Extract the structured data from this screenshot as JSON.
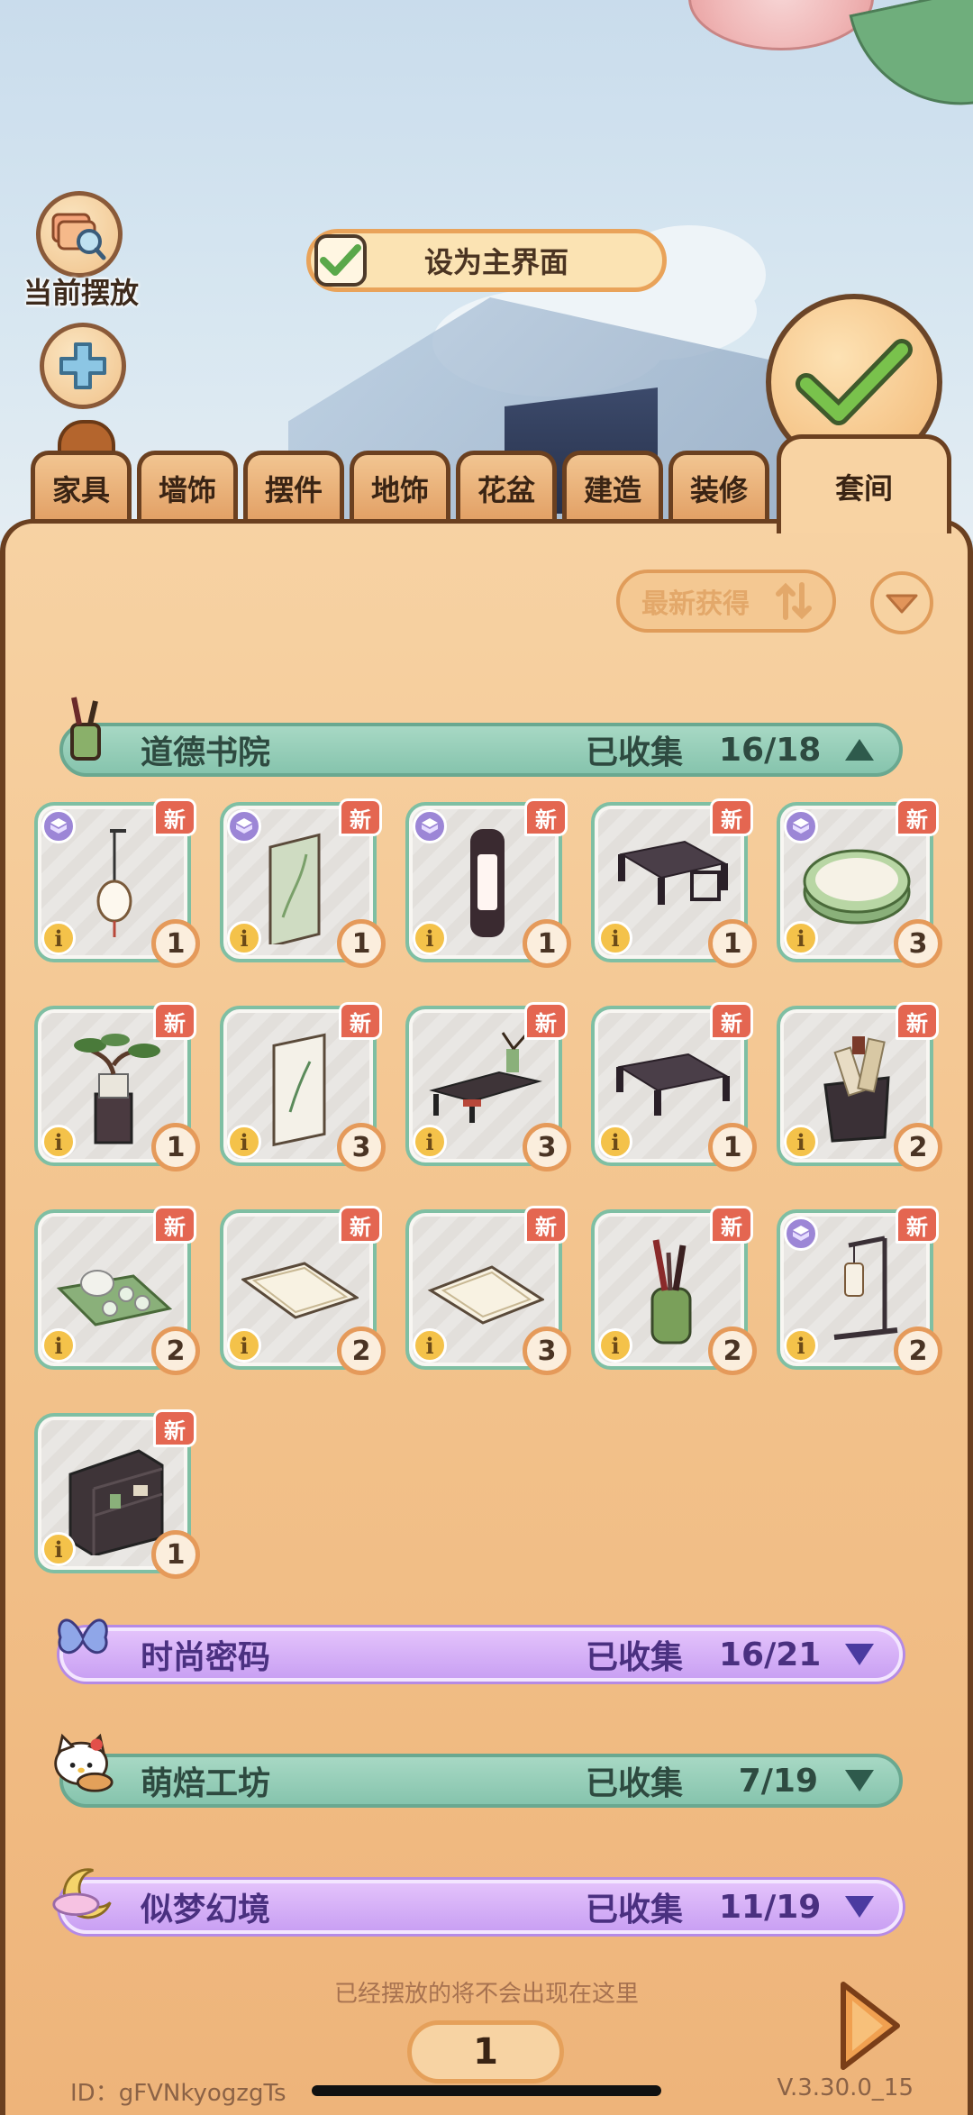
{
  "top": {
    "placed_label": "当前摆放",
    "home_label": "设为主界面"
  },
  "tabs": [
    {
      "label": "家具"
    },
    {
      "label": "墙饰"
    },
    {
      "label": "摆件"
    },
    {
      "label": "地饰"
    },
    {
      "label": "花盆"
    },
    {
      "label": "建造"
    },
    {
      "label": "装修"
    }
  ],
  "active_tab": {
    "label": "套间"
  },
  "sort": {
    "label": "最新获得"
  },
  "categories": [
    {
      "name": "道德书院",
      "collected_label": "已收集",
      "count": "16/18",
      "expanded": true,
      "theme": "green",
      "icon": "brush-pot-icon"
    },
    {
      "name": "时尚密码",
      "collected_label": "已收集",
      "count": "16/21",
      "expanded": false,
      "theme": "purple",
      "icon": "butterfly-icon"
    },
    {
      "name": "萌焙工坊",
      "collected_label": "已收集",
      "count": "7/19",
      "expanded": false,
      "theme": "green",
      "icon": "hello-kitty-icon"
    },
    {
      "name": "似梦幻境",
      "collected_label": "已收集",
      "count": "11/19",
      "expanded": false,
      "theme": "purple",
      "icon": "crescent-moon-icon"
    }
  ],
  "items": [
    {
      "art": "hanging-lantern",
      "new": "新",
      "kit": true,
      "count": "1"
    },
    {
      "art": "hanging-scroll",
      "new": "新",
      "kit": true,
      "count": "1"
    },
    {
      "art": "pillar-lamp",
      "new": "新",
      "kit": true,
      "count": "1"
    },
    {
      "art": "low-bench",
      "new": "新",
      "kit": false,
      "count": "1"
    },
    {
      "art": "round-mat",
      "new": "新",
      "kit": true,
      "count": "3"
    },
    {
      "art": "bonsai-stand",
      "new": "新",
      "kit": false,
      "count": "1"
    },
    {
      "art": "painting-scroll",
      "new": "新",
      "kit": false,
      "count": "3"
    },
    {
      "art": "desk-shelf",
      "new": "新",
      "kit": false,
      "count": "3"
    },
    {
      "art": "low-table",
      "new": "新",
      "kit": false,
      "count": "1"
    },
    {
      "art": "scroll-basket",
      "new": "新",
      "kit": false,
      "count": "2"
    },
    {
      "art": "tea-set",
      "new": "新",
      "kit": false,
      "count": "2"
    },
    {
      "art": "rug-small",
      "new": "新",
      "kit": false,
      "count": "2"
    },
    {
      "art": "rug-large",
      "new": "新",
      "kit": false,
      "count": "3"
    },
    {
      "art": "brush-pot",
      "new": "新",
      "kit": false,
      "count": "2"
    },
    {
      "art": "lantern-stand",
      "new": "新",
      "kit": true,
      "count": "2"
    },
    {
      "art": "bookcase",
      "new": "新",
      "kit": false,
      "count": "1"
    }
  ],
  "footer": {
    "hint": "已经摆放的将不会出现在这里",
    "page": "1",
    "id": "ID：gFVNkyogzgTs",
    "version": "V.3.30.0_15"
  }
}
